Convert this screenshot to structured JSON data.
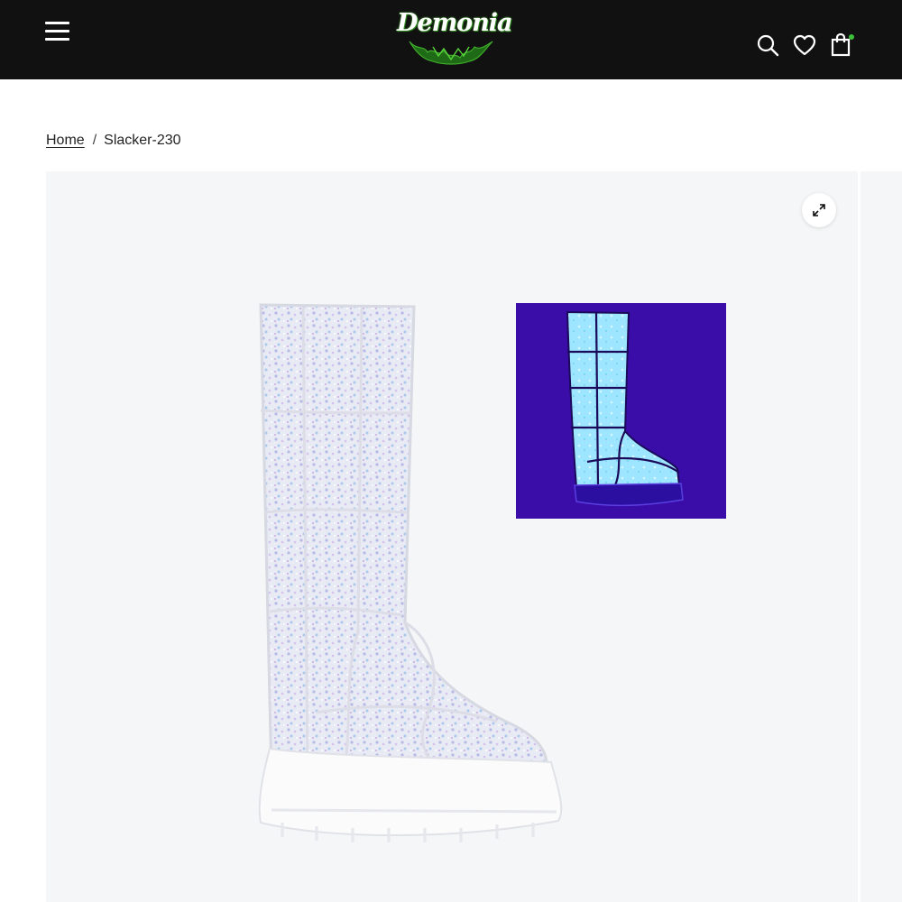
{
  "header": {
    "logo_text": "Demonia",
    "menu_icon": "hamburger-menu-icon",
    "icons": [
      "search-icon",
      "heart-icon",
      "shopping-bag-icon"
    ],
    "cart_indicator_color": "#3cc13b",
    "background_color": "#111111"
  },
  "breadcrumb": {
    "home_label": "Home",
    "separator": "/",
    "current_label": "Slacker-230"
  },
  "gallery": {
    "zoom_icon": "expand-icon",
    "main_image": "white-glitter-knee-high-platform-boot",
    "inset_image": "boot-glowing-under-blacklight",
    "inset_background": "#3a0ca8"
  }
}
